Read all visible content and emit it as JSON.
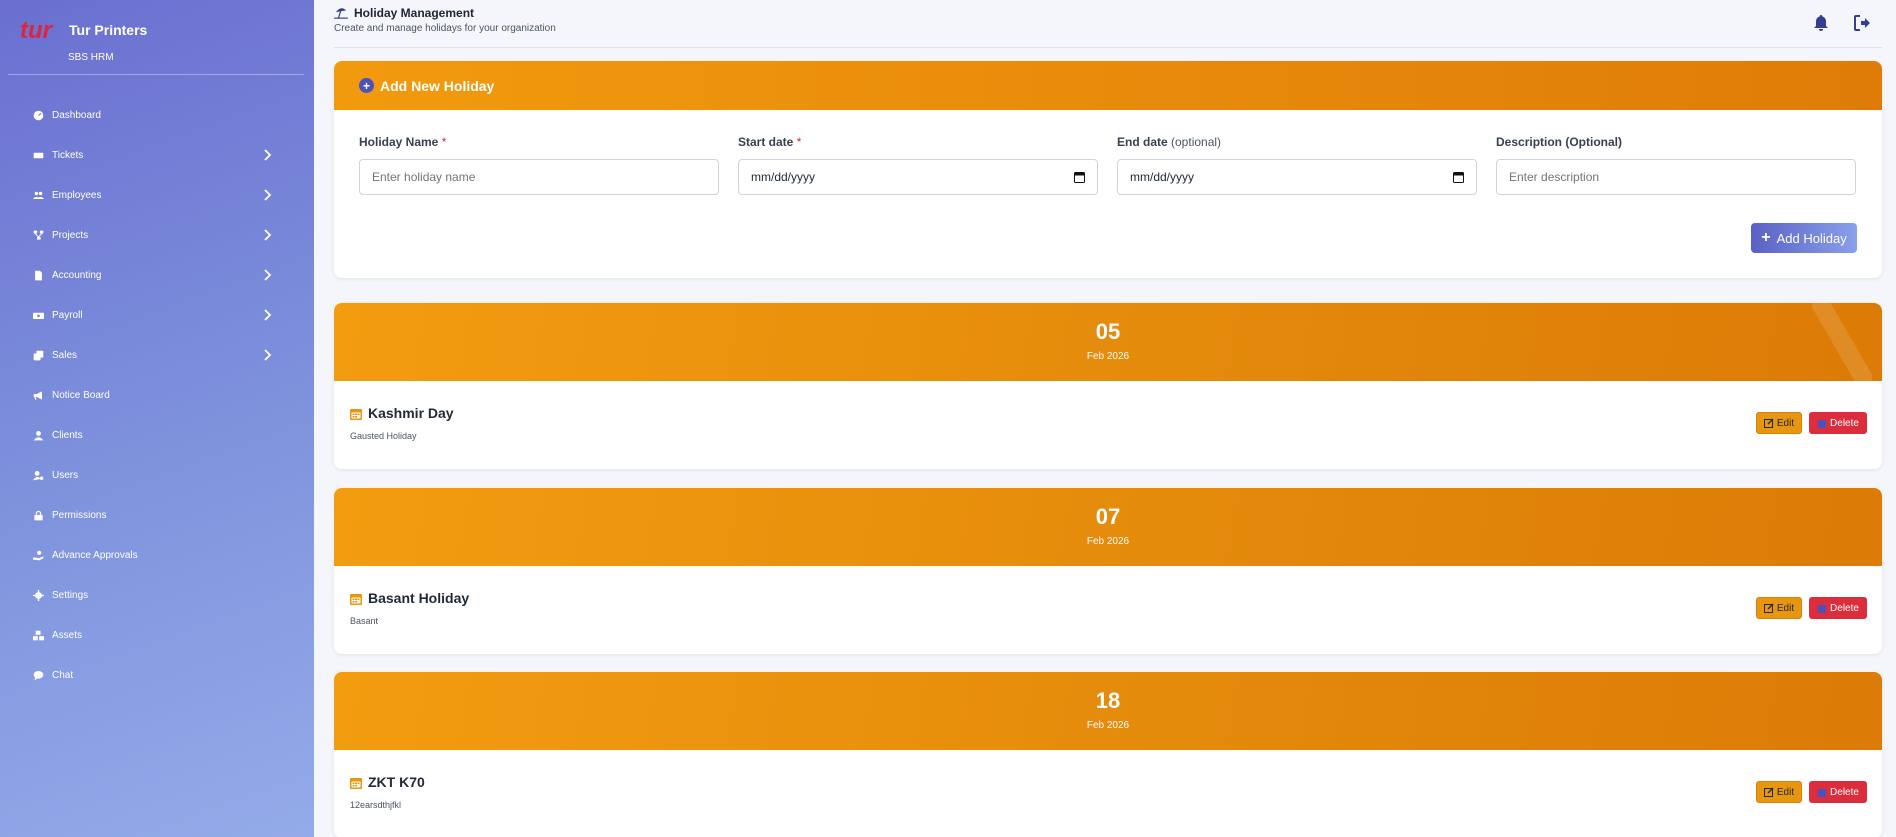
{
  "brand": {
    "name": "Tur Printers",
    "sub": "SBS HRM",
    "logo_text": "tur"
  },
  "sidebar": {
    "items": [
      {
        "label": "Dashboard",
        "icon": "dashboard-icon",
        "chevron": false
      },
      {
        "label": "Tickets",
        "icon": "ticket-icon",
        "chevron": true
      },
      {
        "label": "Employees",
        "icon": "users-icon",
        "chevron": true
      },
      {
        "label": "Projects",
        "icon": "sitemap-icon",
        "chevron": true
      },
      {
        "label": "Accounting",
        "icon": "file-icon",
        "chevron": true
      },
      {
        "label": "Payroll",
        "icon": "money-icon",
        "chevron": true
      },
      {
        "label": "Sales",
        "icon": "copy-icon",
        "chevron": true
      },
      {
        "label": "Notice Board",
        "icon": "bullhorn-icon",
        "chevron": false
      },
      {
        "label": "Clients",
        "icon": "user-icon",
        "chevron": false
      },
      {
        "label": "Users",
        "icon": "user-cog-icon",
        "chevron": false
      },
      {
        "label": "Permissions",
        "icon": "lock-icon",
        "chevron": false
      },
      {
        "label": "Advance Approvals",
        "icon": "hand-money-icon",
        "chevron": false
      },
      {
        "label": "Settings",
        "icon": "gear-icon",
        "chevron": false
      },
      {
        "label": "Assets",
        "icon": "boxes-icon",
        "chevron": false
      },
      {
        "label": "Chat",
        "icon": "chat-icon",
        "chevron": false
      }
    ]
  },
  "header": {
    "title": "Holiday Management",
    "subtitle": "Create and manage holidays for your organization"
  },
  "form": {
    "card_title": "Add New Holiday",
    "name_label": "Holiday Name",
    "name_placeholder": "Enter holiday name",
    "start_label": "Start date",
    "start_value": "mm/dd/yyyy",
    "end_label": "End date",
    "end_optional": "(optional)",
    "end_value": "mm/dd/yyyy",
    "desc_label": "Description (Optional)",
    "desc_placeholder": "Enter description",
    "required_mark": "*",
    "submit_label": "Add Holiday"
  },
  "holidays": [
    {
      "day": "05",
      "month": "Feb 2026",
      "name": "Kashmir Day",
      "description": "Gausted Holiday"
    },
    {
      "day": "07",
      "month": "Feb 2026",
      "name": "Basant Holiday",
      "description": "Basant"
    },
    {
      "day": "18",
      "month": "Feb 2026",
      "name": "ZKT K70",
      "description": "12earsdthjfkl"
    }
  ],
  "actions": {
    "edit_label": "Edit",
    "delete_label": "Delete"
  },
  "colors": {
    "sidebar_start": "#6a6fd0",
    "sidebar_end": "#94abe9",
    "accent_orange": "#f29a0e",
    "delete_red": "#dc2d3c",
    "primary_indigo": "#4b52b8"
  }
}
